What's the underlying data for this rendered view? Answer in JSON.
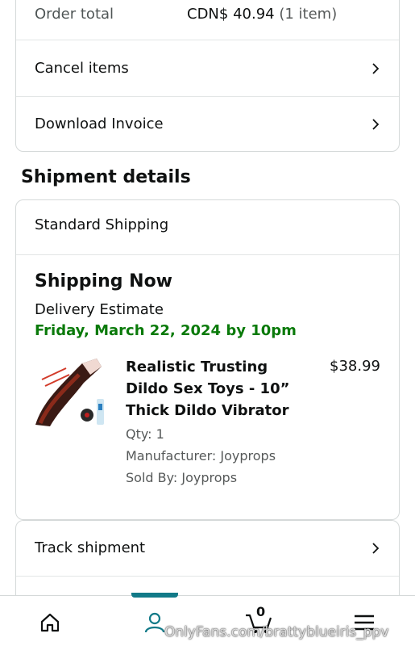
{
  "order_summary": {
    "order_total_label": "Order total",
    "order_total_amount": "CDN$ 40.94",
    "order_total_count": "(1 item)",
    "cancel_label": "Cancel items",
    "invoice_label": "Download Invoice"
  },
  "shipment": {
    "heading": "Shipment details",
    "method": "Standard Shipping",
    "status": "Shipping Now",
    "estimate_label": "Delivery Estimate",
    "estimate_date": "Friday, March 22, 2024 by 10pm",
    "product": {
      "title_line1": "Realistic Trusting",
      "title_line2": "Dildo Sex Toys - 10”",
      "title_line3": "Thick Dildo Vibrator",
      "price": "$38.99",
      "qty": "Qty: 1",
      "manufacturer": "Manufacturer: Joyprops",
      "sold_by": "Sold By: Joyprops"
    },
    "track_label": "Track shipment"
  },
  "bottom_nav": {
    "items": [
      {
        "name": "home",
        "icon": "home-icon"
      },
      {
        "name": "account",
        "icon": "person-icon",
        "active": true
      },
      {
        "name": "cart",
        "icon": "cart-icon"
      },
      {
        "name": "menu",
        "icon": "hamburger-icon"
      }
    ],
    "cart_count": "0"
  },
  "watermark": "OnlyFans.com/brattyblueiris_ppv",
  "colors": {
    "accent": "#127a88",
    "delivery_green": "#0a7a0a",
    "border": "#d5d9d9"
  }
}
